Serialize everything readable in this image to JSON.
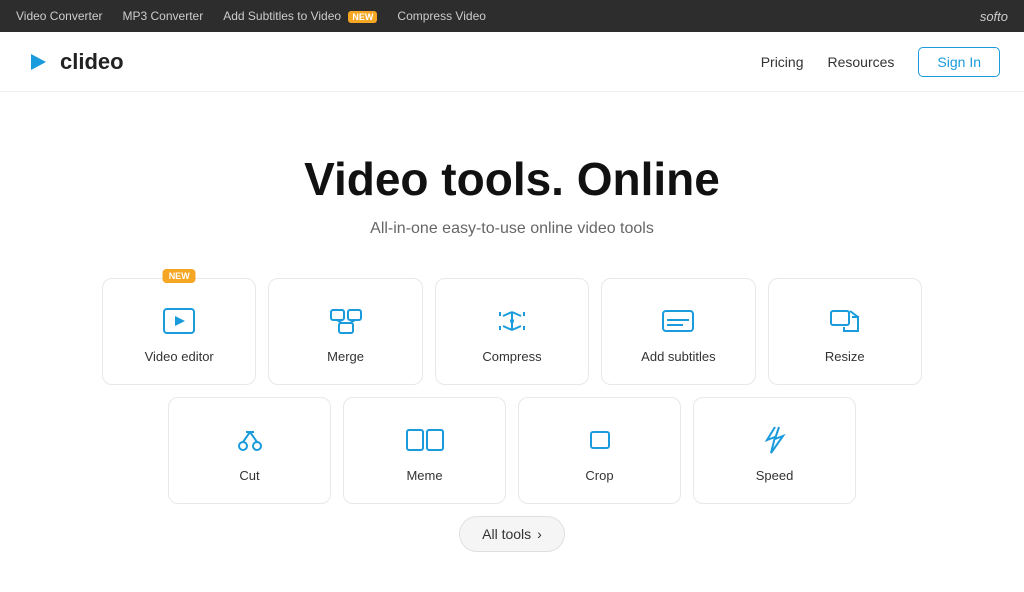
{
  "banner": {
    "links": [
      {
        "label": "Video Converter",
        "id": "video-converter"
      },
      {
        "label": "MP3 Converter",
        "id": "mp3-converter"
      },
      {
        "label": "Add Subtitles to Video",
        "id": "add-subtitles",
        "badge": "NEW"
      },
      {
        "label": "Compress Video",
        "id": "compress-video"
      }
    ],
    "brand": "softo"
  },
  "nav": {
    "logo_text": "clideo",
    "links": [
      {
        "label": "Pricing",
        "id": "pricing"
      },
      {
        "label": "Resources",
        "id": "resources"
      }
    ],
    "signin_label": "Sign In"
  },
  "hero": {
    "title": "Video tools. Online",
    "subtitle": "All-in-one easy-to-use online video tools"
  },
  "tools_row1": [
    {
      "id": "video-editor",
      "label": "Video editor",
      "icon": "play",
      "badge": "NEW"
    },
    {
      "id": "merge",
      "label": "Merge",
      "icon": "merge",
      "badge": null
    },
    {
      "id": "compress",
      "label": "Compress",
      "icon": "compress",
      "badge": null
    },
    {
      "id": "add-subtitles",
      "label": "Add subtitles",
      "icon": "subtitles",
      "badge": null
    },
    {
      "id": "resize",
      "label": "Resize",
      "icon": "resize",
      "badge": null
    }
  ],
  "tools_row2": [
    {
      "id": "cut",
      "label": "Cut",
      "icon": "cut",
      "badge": null
    },
    {
      "id": "meme",
      "label": "Meme",
      "icon": "meme",
      "badge": null
    },
    {
      "id": "crop",
      "label": "Crop",
      "icon": "crop",
      "badge": null
    },
    {
      "id": "speed",
      "label": "Speed",
      "icon": "speed",
      "badge": null
    }
  ],
  "all_tools_label": "All tools",
  "all_tools_chevron": "›"
}
